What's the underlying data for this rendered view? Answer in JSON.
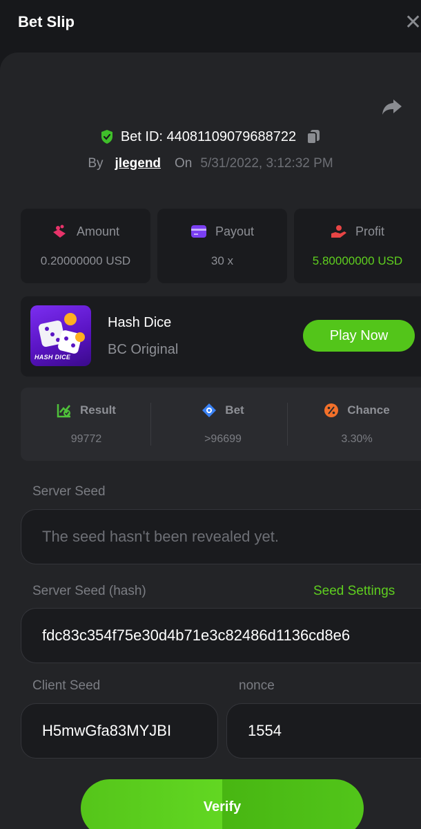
{
  "header": {
    "title": "Bet Slip"
  },
  "bet": {
    "id_label": "Bet ID: 44081109079688722",
    "by": "By",
    "user": "jlegend",
    "on": "On",
    "date": "5/31/2022, 3:12:32 PM"
  },
  "stats": [
    {
      "label": "Amount",
      "value": "0.20000000 USD"
    },
    {
      "label": "Payout",
      "value": "30 x"
    },
    {
      "label": "Profit",
      "value": "5.80000000 USD"
    }
  ],
  "game": {
    "thumb_text": "HASH DICE",
    "title": "Hash Dice",
    "subtitle": "BC Original",
    "play_label": "Play Now"
  },
  "results": [
    {
      "label": "Result",
      "value": "99772"
    },
    {
      "label": "Bet",
      "value": ">96699"
    },
    {
      "label": "Chance",
      "value": "3.30%"
    }
  ],
  "seeds": {
    "server_label": "Server Seed",
    "server_placeholder": "The seed hasn't been revealed yet.",
    "hash_label": "Server Seed (hash)",
    "settings_label": "Seed Settings",
    "hash_value": "fdc83c354f75e30d4b71e3c82486d1136cd8e6",
    "client_label": "Client Seed",
    "client_value": "H5mwGfa83MYJBI",
    "nonce_label": "nonce",
    "nonce_value": "1554"
  },
  "verify_label": "Verify",
  "colors": {
    "accent": "#53c51a",
    "panel": "#232427",
    "card": "#1a1b1e"
  }
}
